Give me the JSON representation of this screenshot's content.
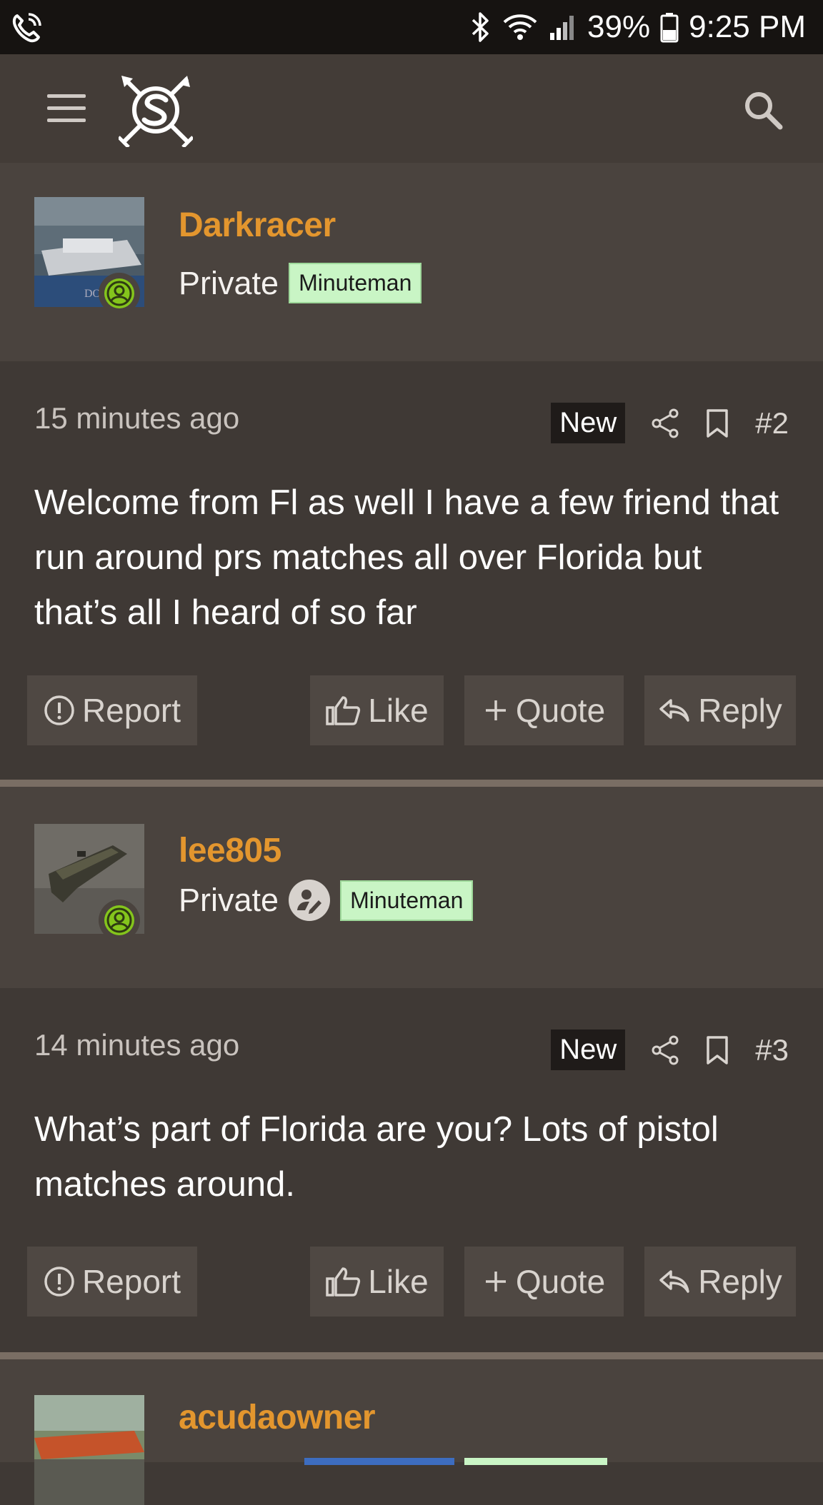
{
  "status_bar": {
    "battery": "39%",
    "time": "9:25 PM",
    "icons": [
      "phone-wifi-call-icon",
      "bluetooth-icon",
      "wifi-icon",
      "signal-icon",
      "battery-icon"
    ]
  },
  "header": {
    "menu_icon": "hamburger-icon",
    "logo": "site-logo",
    "search_icon": "search-icon"
  },
  "posts": [
    {
      "username": "Darkracer",
      "title": "Private",
      "banner": "Minuteman",
      "time": "15 minutes ago",
      "badge": "New",
      "number": "#2",
      "text": "Welcome from Fl as well I have a few friend that run around prs matches all over Florida but that’s all I heard of so far",
      "actions": {
        "report": "Report",
        "like": "Like",
        "quote": "Quote",
        "reply": "Reply"
      }
    },
    {
      "username": "lee805",
      "title": "Private",
      "banner": "Minuteman",
      "time": "14 minutes ago",
      "badge": "New",
      "number": "#3",
      "text": "What’s part of Florida are you? Lots of pistol matches around.",
      "actions": {
        "report": "Report",
        "like": "Like",
        "quote": "Quote",
        "reply": "Reply"
      }
    },
    {
      "username": "acudaowner"
    }
  ],
  "colors": {
    "username": "#e3962e",
    "banner_bg": "#c9f5c5",
    "online": "#84c51c",
    "page_bg": "#3f3935",
    "user_block_bg": "#4a433e"
  }
}
